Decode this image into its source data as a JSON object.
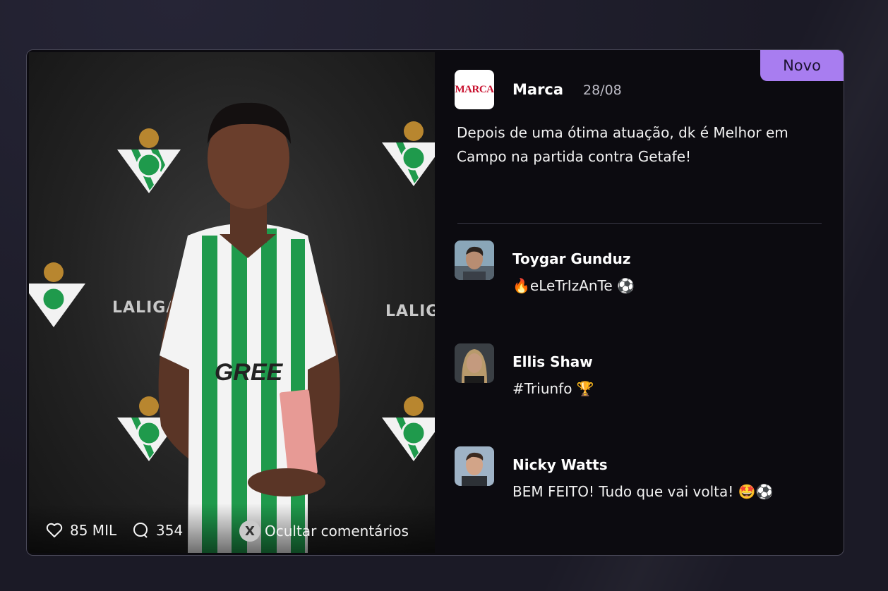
{
  "badge": {
    "label": "Novo"
  },
  "post": {
    "publisher_logo_text": "MARCA",
    "publisher": "Marca",
    "date": "28/08",
    "text": "Depois de uma ótima atuação, dk é Melhor em Campo na partida contra Getafe!"
  },
  "image": {
    "sponsor_text": "GREE",
    "league_text": "LALIGA",
    "likes": "85 MIL",
    "comments_count": "354",
    "hide_button_key": "X",
    "hide_button_label": "Ocultar comentários"
  },
  "comments": [
    {
      "author": "Toygar Gunduz",
      "text": "🔥eLeTrIzAnTe ⚽"
    },
    {
      "author": "Ellis Shaw",
      "text": "#Triunfo 🏆"
    },
    {
      "author": "Nicky Watts",
      "text": "BEM FEITO! Tudo que vai volta! 🤩⚽"
    }
  ],
  "colors": {
    "background": "#1b1a26",
    "card": "#0c0b10",
    "badge": "#a87df0",
    "kit_green": "#1f9a4c"
  }
}
